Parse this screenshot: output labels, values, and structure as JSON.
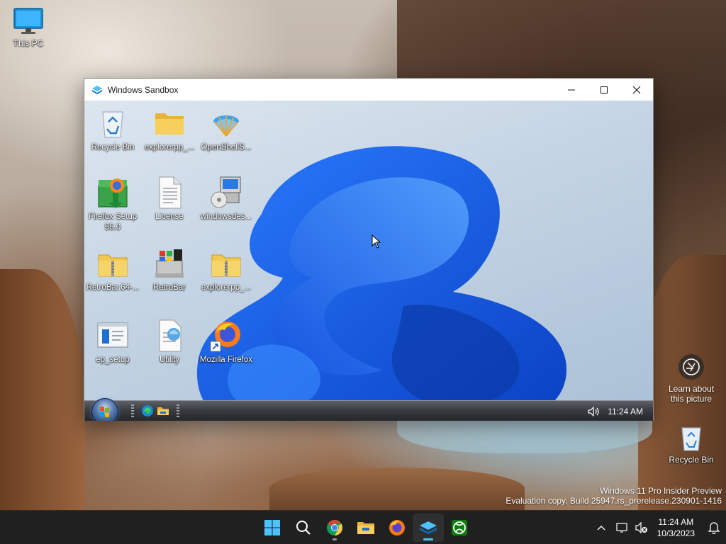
{
  "host_desktop": {
    "icons": [
      {
        "label": "This PC",
        "icon": "monitor-icon"
      },
      {
        "label": "Recycle Bin",
        "icon": "recycle-bin-icon"
      }
    ],
    "spotlight": {
      "label_line1": "Learn about",
      "label_line2": "this picture",
      "icon": "camera-icon"
    },
    "watermark": {
      "line1": "Windows 11 Pro Insider Preview",
      "line2": "Evaluation copy. Build 25947.rs_prerelease.230901-1416"
    }
  },
  "window": {
    "title": "Windows Sandbox",
    "controls": {
      "minimize": "minimize-icon",
      "maximize": "maximize-icon",
      "close": "close-icon"
    }
  },
  "sandbox_desktop": {
    "icons": [
      {
        "label": "Recycle Bin",
        "icon": "recycle-bin-icon"
      },
      {
        "label": "explorerpp_...",
        "icon": "folder-icon"
      },
      {
        "label": "OpenShellS...",
        "icon": "shell-icon"
      },
      {
        "label": "Firefox Setup 55.0",
        "icon": "installer-icon"
      },
      {
        "label": "License",
        "icon": "text-file-icon"
      },
      {
        "label": "windowsdes...",
        "icon": "setup-cd-icon"
      },
      {
        "label": "RetroBar.64-...",
        "icon": "zip-folder-icon"
      },
      {
        "label": "RetroBar",
        "icon": "retrobar-app-icon"
      },
      {
        "label": "explorerpp_...",
        "icon": "zip-folder-icon"
      },
      {
        "label": "ep_setup",
        "icon": "ep-setup-icon"
      },
      {
        "label": "Utility",
        "icon": "utility-icon"
      },
      {
        "label": "Mozilla Firefox",
        "icon": "firefox-icon"
      }
    ],
    "taskbar": {
      "start": "start-orb-icon",
      "pinned": [
        "edge-icon",
        "file-explorer-icon"
      ],
      "time": "11:24 AM",
      "volume": "volume-icon"
    }
  },
  "taskbar": {
    "apps": [
      {
        "name": "Start",
        "icon": "windows-start-icon"
      },
      {
        "name": "Search",
        "icon": "search-icon"
      },
      {
        "name": "Google Chrome",
        "icon": "chrome-icon"
      },
      {
        "name": "File Explorer",
        "icon": "folder-icon"
      },
      {
        "name": "Firefox",
        "icon": "firefox-icon"
      },
      {
        "name": "Windows Sandbox",
        "icon": "sandbox-icon"
      },
      {
        "name": "Xbox",
        "icon": "xbox-icon"
      }
    ],
    "tray": {
      "time": "11:24 AM",
      "date": "10/3/2023"
    }
  },
  "colors": {
    "accent": "#4cc2ff",
    "taskbar": "#202020",
    "sandbox_taskbar": "#2b2d31"
  }
}
